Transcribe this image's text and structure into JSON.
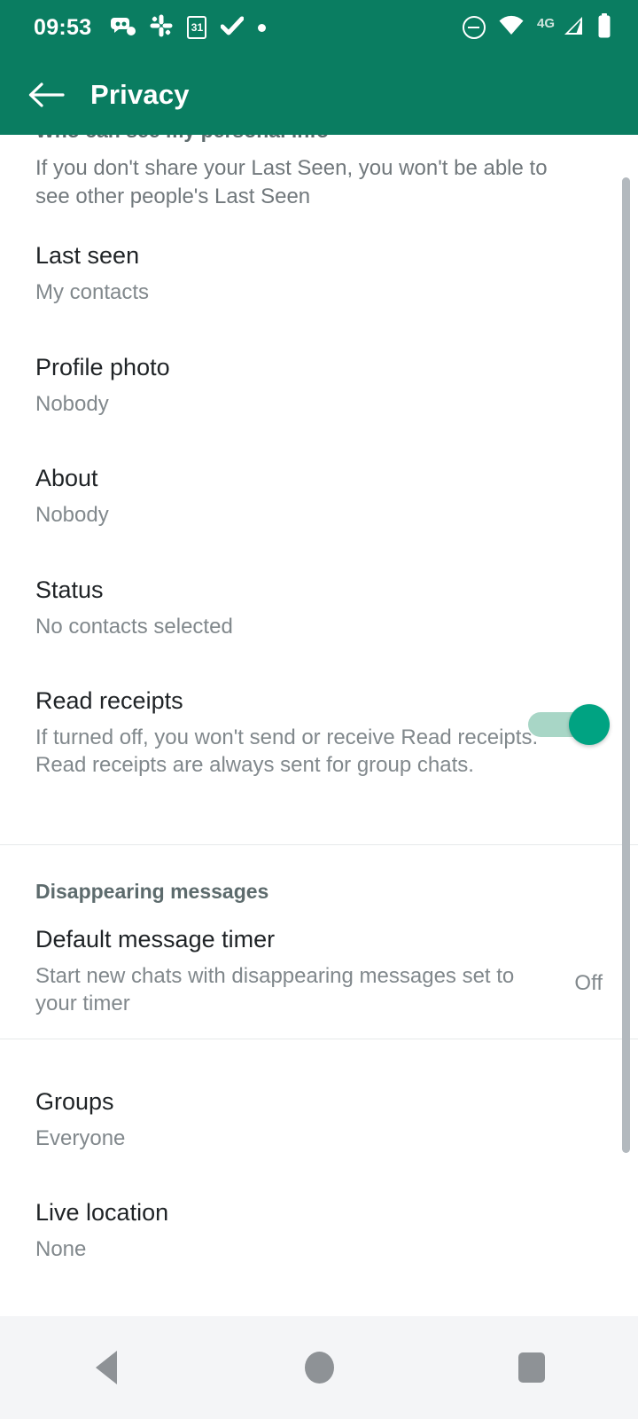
{
  "status_bar": {
    "time": "09:53",
    "left_icons": [
      {
        "name": "chat-notification-icon",
        "glyph": "⚈"
      },
      {
        "name": "slack-notification-icon",
        "glyph": "✽"
      },
      {
        "name": "calendar-notification-icon",
        "glyph": "31"
      },
      {
        "name": "checkmark-notification-icon",
        "glyph": "✔"
      },
      {
        "name": "dot-notification-icon",
        "glyph": "•"
      }
    ],
    "right_icons": [
      {
        "name": "do-not-disturb-icon"
      },
      {
        "name": "wifi-icon"
      },
      {
        "name": "network-type-label",
        "label": "4G"
      },
      {
        "name": "cellular-signal-icon"
      },
      {
        "name": "battery-icon"
      }
    ]
  },
  "toolbar": {
    "back_label": "←",
    "title": "Privacy"
  },
  "colors": {
    "toolbar_green": "#0a7d61",
    "toggle_on_thumb": "#00a382",
    "toggle_on_track": "#a8d6c6",
    "primary_text": "#1f2326",
    "secondary_text": "#81888c",
    "section_header_text": "#5d6b6d",
    "nav_icon": "#8e9296",
    "nav_background": "#f4f5f7",
    "divider": "#e6e9ea",
    "scrollbar": "#b3b9be"
  },
  "content": {
    "clipped_section_header": "Who can see my personal info",
    "personal_info_description": "If you don't share your Last Seen, you won't be able to see other people's Last Seen",
    "items": {
      "last_seen": {
        "title": "Last seen",
        "value": "My contacts"
      },
      "profile_photo": {
        "title": "Profile photo",
        "value": "Nobody"
      },
      "about": {
        "title": "About",
        "value": "Nobody"
      },
      "status": {
        "title": "Status",
        "value": "No contacts selected"
      },
      "read_receipts": {
        "title": "Read receipts",
        "description": "If turned off, you won't send or receive Read receipts. Read receipts are always sent for group chats.",
        "toggle_on": true
      },
      "disappearing_messages_header": "Disappearing messages",
      "default_message_timer": {
        "title": "Default message timer",
        "description": "Start new chats with disappearing messages set to your timer",
        "value": "Off"
      },
      "groups": {
        "title": "Groups",
        "value": "Everyone"
      },
      "live_location": {
        "title": "Live location",
        "value": "None"
      }
    }
  },
  "nav_bar": {
    "back": "back-button",
    "home": "home-button",
    "recents": "recents-button"
  }
}
